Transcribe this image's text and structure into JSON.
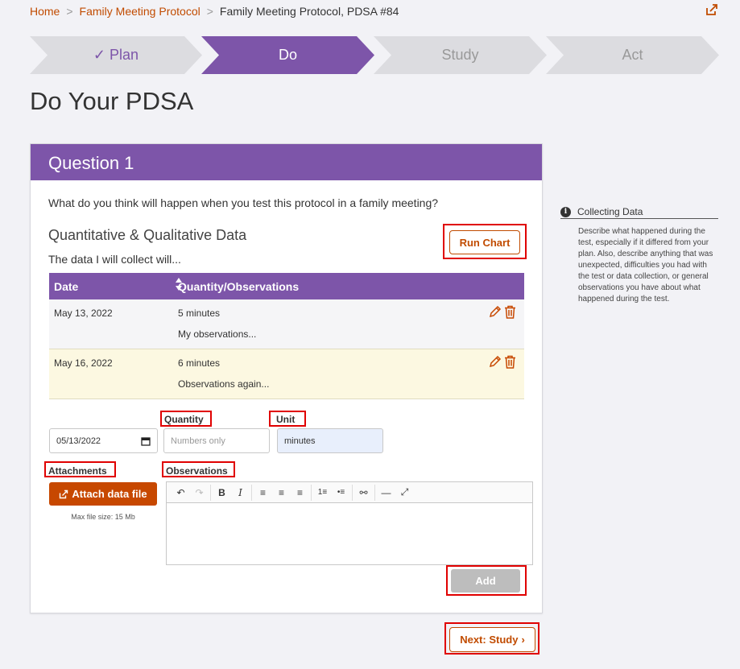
{
  "breadcrumb": {
    "home": "Home",
    "sep1": ">",
    "parent": "Family Meeting Protocol",
    "sep2": ">",
    "current": "Family Meeting Protocol, PDSA #84"
  },
  "steps": [
    {
      "label": "Plan",
      "prefix": "✓",
      "state": "complete"
    },
    {
      "label": "Do",
      "state": "active"
    },
    {
      "label": "Study",
      "state": "upcoming"
    },
    {
      "label": "Act",
      "state": "upcoming"
    }
  ],
  "page_title": "Do Your PDSA",
  "card": {
    "header": "Question 1",
    "question": "What do you think will happen when you test this protocol in a family meeting?",
    "section_title": "Quantitative & Qualitative Data",
    "section_sub": "The data I will collect will...",
    "run_chart_label": "Run Chart",
    "table": {
      "headers": [
        "Date",
        "Quantity/Observations"
      ],
      "rows": [
        {
          "date": "May 13, 2022",
          "quantity": "5 minutes",
          "observation": "My observations..."
        },
        {
          "date": "May 16, 2022",
          "quantity": "6 minutes",
          "observation": "Observations again..."
        }
      ]
    },
    "form": {
      "quantity_label": "Quantity",
      "unit_label": "Unit",
      "date_value": "05/13/2022",
      "quantity_placeholder": "Numbers only",
      "unit_value": "minutes",
      "attachments_label": "Attachments",
      "attach_button": "Attach data file",
      "max_file_size": "Max file size: 15 Mb",
      "observations_label": "Observations",
      "add_button": "Add"
    }
  },
  "next_button": "Next: Study",
  "sidebar": {
    "title": "Collecting Data",
    "text": "Describe what happened during the test, especially if it differed from your plan. Also, describe anything that was unexpected, difficulties you had with the test or data collection, or general observations you have about what happened during the test."
  },
  "colors": {
    "accent": "#7d55a9",
    "link": "#c14b00",
    "highlight": "#e00000"
  }
}
